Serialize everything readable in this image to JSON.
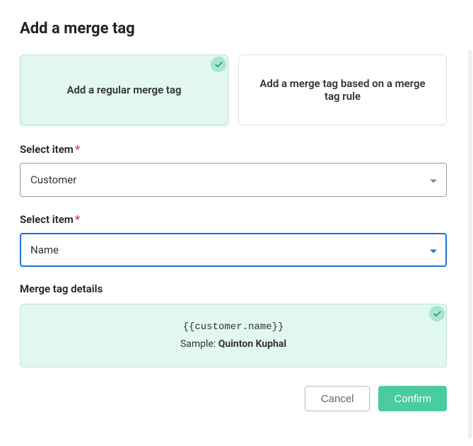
{
  "title": "Add a merge tag",
  "options": {
    "regular": "Add a regular merge tag",
    "rule": "Add a merge tag based on a merge tag rule"
  },
  "fields": {
    "item1": {
      "label": "Select item",
      "value": "Customer"
    },
    "item2": {
      "label": "Select item",
      "value": "Name"
    }
  },
  "details": {
    "label": "Merge tag details",
    "code": "{{customer.name}}",
    "sample_label": "Sample: ",
    "sample_value": "Quinton Kuphal"
  },
  "buttons": {
    "cancel": "Cancel",
    "confirm": "Confirm"
  }
}
